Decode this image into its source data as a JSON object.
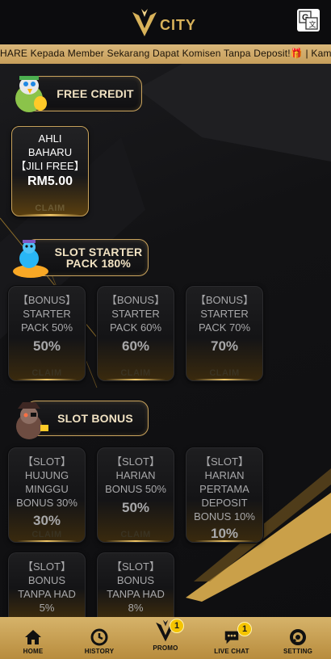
{
  "header": {
    "logo_text": "CITY",
    "translate_icon": "google-translate-icon"
  },
  "marquee": {
    "text": "HARE Kepada Member Sekarang Dapat Komisen Tanpa Deposit!🎁 | Kami T"
  },
  "sections": {
    "free_credit": {
      "label": "FREE CREDIT",
      "mascot": "parrot-mascot-icon",
      "cards": [
        {
          "title_line1": "AHLI BAHARU",
          "title_line2": "【JILI FREE】",
          "value": "RM5.00",
          "claim": "CLAIM"
        }
      ]
    },
    "slot_starter": {
      "label_line1": "SLOT STARTER",
      "label_line2": "PACK 180%",
      "mascot": "genie-mascot-icon",
      "cards": [
        {
          "title": "【BONUS】STARTER PACK 50%",
          "value": "50%",
          "claim": "CLAIM"
        },
        {
          "title": "【BONUS】STARTER PACK 60%",
          "value": "60%",
          "claim": "CLAIM"
        },
        {
          "title": "【BONUS】STARTER PACK 70%",
          "value": "70%",
          "claim": "CLAIM"
        }
      ]
    },
    "slot_bonus": {
      "label": "SLOT BONUS",
      "mascot": "pirate-mascot-icon",
      "cards": [
        {
          "title": "【SLOT】HUJUNG MINGGU BONUS 30%",
          "value": "30%",
          "claim": "CLAIM"
        },
        {
          "title": "【SLOT】HARIAN BONUS 50%",
          "value": "50%",
          "claim": "CLAIM"
        },
        {
          "title": "【SLOT】HARIAN PERTAMA DEPOSIT BONUS 10%",
          "value": "10%",
          "claim": "CLAIM"
        },
        {
          "title": "【SLOT】BONUS TANPA HAD 5%",
          "value": "",
          "claim": ""
        },
        {
          "title": "【SLOT】BONUS TANPA HAD 8%",
          "value": "",
          "claim": ""
        }
      ]
    }
  },
  "nav": {
    "items": [
      {
        "label": "HOME",
        "icon": "home-icon"
      },
      {
        "label": "HISTORY",
        "icon": "history-icon"
      },
      {
        "label": "PROMO",
        "icon": "promo-logo-icon",
        "badge": "1"
      },
      {
        "label": "LIVE CHAT",
        "icon": "chat-icon",
        "badge": "1"
      },
      {
        "label": "SETTING",
        "icon": "setting-icon"
      }
    ]
  },
  "colors": {
    "gold": "#c9a35d",
    "nav_gold": "#d6b36a",
    "badge": "#f5c400",
    "background": "#111113"
  }
}
